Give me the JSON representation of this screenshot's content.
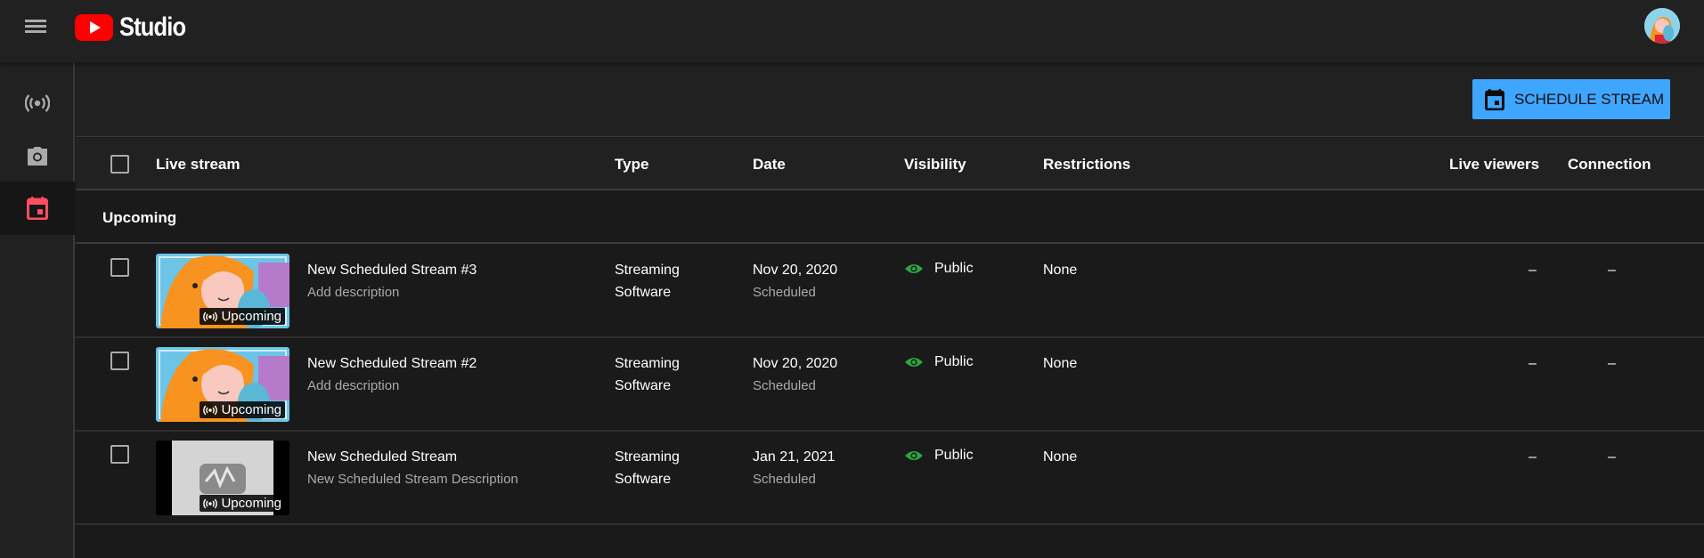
{
  "app": {
    "title": "Studio"
  },
  "header": {
    "menu_icon": "hamburger-menu-icon",
    "avatar_icon": "channel-avatar"
  },
  "sidebar": {
    "items": [
      {
        "name": "live",
        "icon": "live-broadcast-icon",
        "active": false
      },
      {
        "name": "webcam",
        "icon": "camera-icon",
        "active": false
      },
      {
        "name": "manage",
        "icon": "calendar-icon",
        "active": true
      }
    ]
  },
  "toolbar": {
    "schedule_label": "SCHEDULE STREAM"
  },
  "colors": {
    "accent": "#3ea6ff",
    "active_sidebar": "#ff4e5f",
    "public": "#2ba640",
    "logo": "#ff0000"
  },
  "table": {
    "columns": {
      "live_stream": "Live stream",
      "type": "Type",
      "date": "Date",
      "visibility": "Visibility",
      "restrictions": "Restrictions",
      "live_viewers": "Live viewers",
      "connection": "Connection"
    },
    "section": "Upcoming",
    "rows": [
      {
        "title": "New Scheduled Stream #3",
        "description": "Add description",
        "badge": "Upcoming",
        "type_line1": "Streaming",
        "type_line2": "Software",
        "date": "Nov 20, 2020",
        "date_status": "Scheduled",
        "visibility": "Public",
        "restrictions": "None",
        "live_viewers": "–",
        "connection": "–",
        "thumbnail": "illustration"
      },
      {
        "title": "New Scheduled Stream #2",
        "description": "Add description",
        "badge": "Upcoming",
        "type_line1": "Streaming",
        "type_line2": "Software",
        "date": "Nov 20, 2020",
        "date_status": "Scheduled",
        "visibility": "Public",
        "restrictions": "None",
        "live_viewers": "–",
        "connection": "–",
        "thumbnail": "illustration"
      },
      {
        "title": "New Scheduled Stream",
        "description": "New Scheduled Stream Description",
        "badge": "Upcoming",
        "type_line1": "Streaming",
        "type_line2": "Software",
        "date": "Jan 21, 2021",
        "date_status": "Scheduled",
        "visibility": "Public",
        "restrictions": "None",
        "live_viewers": "–",
        "connection": "–",
        "thumbnail": "placeholder"
      }
    ]
  }
}
